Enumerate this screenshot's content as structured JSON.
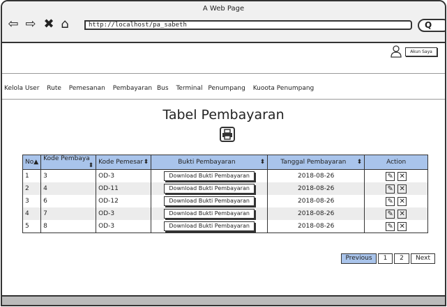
{
  "window": {
    "title": "A Web Page",
    "url": "http://localhost/pa_sabeth"
  },
  "account": {
    "label": "Akun Saya"
  },
  "menu": [
    "Kelola User",
    "Rute",
    "Pemesanan",
    "Pembayaran",
    "Bus",
    "Terminal",
    "Penumpang",
    "Kuoota Penumpang"
  ],
  "page": {
    "title": "Tabel Pembayaran"
  },
  "table": {
    "headers": [
      "No",
      "Kode Pembaya",
      "Kode Pemesar",
      "Bukti Pembayaran",
      "Tanggal Pembayaran",
      "Action"
    ],
    "rows": [
      {
        "no": "1",
        "kode_pembayaran": "3",
        "kode_pemesanan": "OD-3",
        "bukti": "Download Bukti Pembayaran",
        "tanggal": "2018-08-26"
      },
      {
        "no": "2",
        "kode_pembayaran": "4",
        "kode_pemesanan": "OD-11",
        "bukti": "Download Bukti Pembayaran",
        "tanggal": "2018-08-26"
      },
      {
        "no": "3",
        "kode_pembayaran": "6",
        "kode_pemesanan": "OD-12",
        "bukti": "Download Bukti Pembayaran",
        "tanggal": "2018-08-26"
      },
      {
        "no": "4",
        "kode_pembayaran": "7",
        "kode_pemesanan": "OD-3",
        "bukti": "Download Bukti Pembayaran",
        "tanggal": "2018-08-26"
      },
      {
        "no": "5",
        "kode_pembayaran": "8",
        "kode_pemesanan": "OD-3",
        "bukti": "Download Bukti Pembayaran",
        "tanggal": "2018-08-26"
      }
    ]
  },
  "pagination": {
    "previous": "Previous",
    "pages": [
      "1",
      "2"
    ],
    "next": "Next"
  },
  "colors": {
    "header_bg": "#a9c4eb",
    "previous_bg": "#a9c4eb",
    "alt_row": "#ececec"
  }
}
